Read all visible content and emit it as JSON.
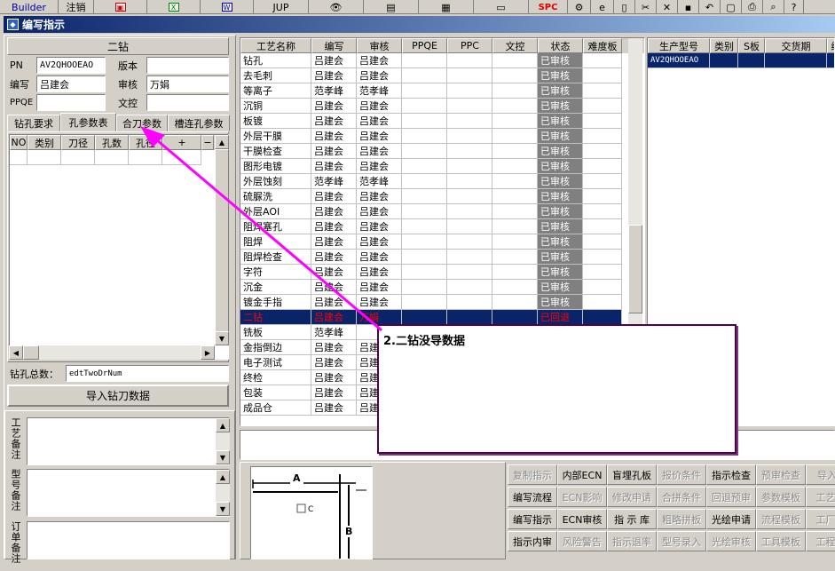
{
  "toolbar": {
    "builder": "Builder",
    "logout": "注销",
    "jup": "JUP",
    "spc": "SPC"
  },
  "window_title": "编写指示",
  "left": {
    "header": "二钻",
    "pn_label": "PN",
    "pn_value": "AV2QHOOEAO",
    "version_label": "版本",
    "version_value": "",
    "writer_label": "编写",
    "writer_value": "吕建会",
    "review_label": "审核",
    "review_value": "万娟",
    "ppqe_label": "PPQE",
    "ppqe_value": "",
    "doc_label": "文控",
    "doc_value": "",
    "tabs": [
      "钻孔要求",
      "孔参数表",
      "合刀参数",
      "槽连孔参数"
    ],
    "active_tab": 1,
    "param_columns": [
      "NO",
      "类别",
      "刀径",
      "孔数",
      "孔径",
      "+",
      "−"
    ],
    "total_label": "钻孔总数：",
    "total_value": "edtTwoDrNum",
    "import_button": "导入钻刀数据",
    "notes": [
      "工艺备注",
      "型号备注",
      "订单备注"
    ]
  },
  "process_grid": {
    "columns": [
      "工艺名称",
      "编写",
      "审核",
      "PPQE",
      "PPC",
      "文控",
      "状态",
      "难度板"
    ],
    "rows": [
      [
        "钻孔",
        "吕建会",
        "吕建会",
        "",
        "",
        "",
        "已审核",
        ""
      ],
      [
        "去毛刺",
        "吕建会",
        "吕建会",
        "",
        "",
        "",
        "已审核",
        ""
      ],
      [
        "等离子",
        "范孝峰",
        "范孝峰",
        "",
        "",
        "",
        "已审核",
        ""
      ],
      [
        "沉铜",
        "吕建会",
        "吕建会",
        "",
        "",
        "",
        "已审核",
        ""
      ],
      [
        "板镀",
        "吕建会",
        "吕建会",
        "",
        "",
        "",
        "已审核",
        ""
      ],
      [
        "外层干膜",
        "吕建会",
        "吕建会",
        "",
        "",
        "",
        "已审核",
        ""
      ],
      [
        "干膜检查",
        "吕建会",
        "吕建会",
        "",
        "",
        "",
        "已审核",
        ""
      ],
      [
        "图形电镀",
        "吕建会",
        "吕建会",
        "",
        "",
        "",
        "已审核",
        ""
      ],
      [
        "外层蚀刻",
        "范孝峰",
        "范孝峰",
        "",
        "",
        "",
        "已审核",
        ""
      ],
      [
        "硫脲洗",
        "吕建会",
        "吕建会",
        "",
        "",
        "",
        "已审核",
        ""
      ],
      [
        "外层AOI",
        "吕建会",
        "吕建会",
        "",
        "",
        "",
        "已审核",
        ""
      ],
      [
        "阻焊塞孔",
        "吕建会",
        "吕建会",
        "",
        "",
        "",
        "已审核",
        ""
      ],
      [
        "阻焊",
        "吕建会",
        "吕建会",
        "",
        "",
        "",
        "已审核",
        ""
      ],
      [
        "阻焊检查",
        "吕建会",
        "吕建会",
        "",
        "",
        "",
        "已审核",
        ""
      ],
      [
        "字符",
        "吕建会",
        "吕建会",
        "",
        "",
        "",
        "已审核",
        ""
      ],
      [
        "沉金",
        "吕建会",
        "吕建会",
        "",
        "",
        "",
        "已审核",
        ""
      ],
      [
        "镀金手指",
        "吕建会",
        "吕建会",
        "",
        "",
        "",
        "已审核",
        ""
      ],
      [
        "二钻",
        "吕建会",
        "万娟",
        "",
        "",
        "",
        "已回退",
        ""
      ],
      [
        "铣板",
        "范孝峰",
        "",
        "",
        "",
        "",
        "",
        ""
      ],
      [
        "金指倒边",
        "吕建会",
        "吕建",
        "",
        "",
        "",
        "",
        ""
      ],
      [
        "电子测试",
        "吕建会",
        "吕建",
        "",
        "",
        "",
        "",
        ""
      ],
      [
        "终检",
        "吕建会",
        "吕建",
        "",
        "",
        "",
        "",
        ""
      ],
      [
        "包装",
        "吕建会",
        "吕建",
        "",
        "",
        "",
        "",
        ""
      ],
      [
        "成品仓",
        "吕建会",
        "吕建",
        "",
        "",
        "",
        "",
        ""
      ]
    ],
    "selected_row": 17
  },
  "product_grid": {
    "columns": [
      "生产型号",
      "类别",
      "S板",
      "交货期",
      "编"
    ],
    "rows": [
      [
        "AV2QHOOEAO",
        "",
        "",
        "",
        ""
      ]
    ]
  },
  "diagram": {
    "a": "A",
    "b": "B",
    "c": "C"
  },
  "callout": "2.二钻没导数据",
  "buttons": [
    [
      [
        "复制指示",
        false
      ],
      [
        "内部ECN",
        true
      ],
      [
        "盲埋孔板",
        true
      ],
      [
        "报价条件",
        false
      ],
      [
        "指示检查",
        true
      ],
      [
        "预审检查",
        false
      ],
      [
        "导入C",
        false
      ]
    ],
    [
      [
        "编写流程",
        true
      ],
      [
        "ECN影响",
        false
      ],
      [
        "修改申请",
        false
      ],
      [
        "合拼条件",
        false
      ],
      [
        "回退预审",
        false
      ],
      [
        "参数模板",
        false
      ],
      [
        "工艺计",
        false
      ]
    ],
    [
      [
        "编写指示",
        true
      ],
      [
        "ECN审核",
        true
      ],
      [
        "指 示 库",
        true
      ],
      [
        "粗略拼板",
        false
      ],
      [
        "光绘申请",
        true
      ],
      [
        "流程模板",
        false
      ],
      [
        "工厂警",
        false
      ]
    ],
    [
      [
        "指示内审",
        true
      ],
      [
        "风险警告",
        false
      ],
      [
        "指示退率",
        false
      ],
      [
        "型号录入",
        false
      ],
      [
        "光绘审核",
        false
      ],
      [
        "工具模板",
        false
      ],
      [
        "工程暂",
        false
      ]
    ]
  ],
  "colors": {
    "title_bar": "#0a246a",
    "selection": "#0a246a",
    "arrow": "#ff00ff",
    "rejected_text": "#ff0000"
  }
}
